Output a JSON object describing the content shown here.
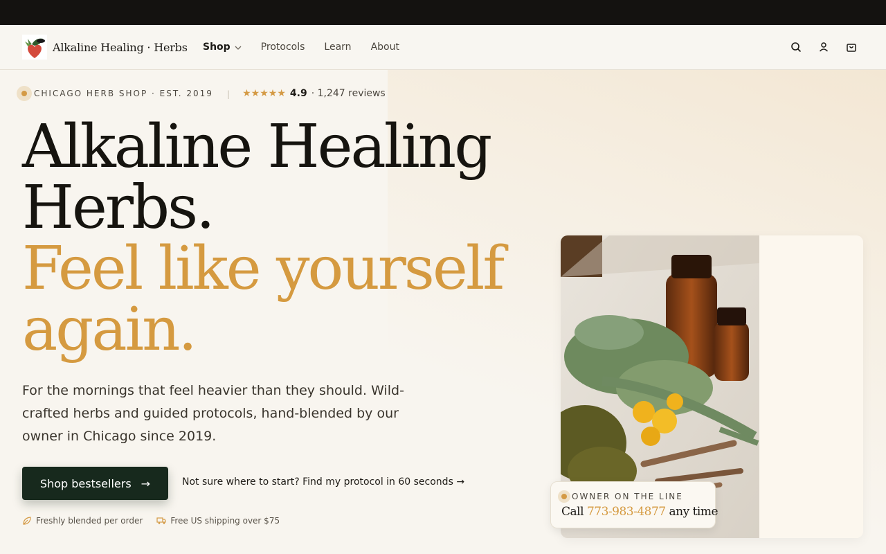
{
  "brand": {
    "name": "Alkaline Healing · Herbs"
  },
  "nav": {
    "items": [
      {
        "label": "Shop"
      },
      {
        "label": "Protocols"
      },
      {
        "label": "Learn"
      },
      {
        "label": "About"
      }
    ],
    "icons": [
      "search-icon",
      "account-icon",
      "cart-icon"
    ]
  },
  "hero": {
    "eyebrow": "CHICAGO HERB SHOP · EST. 2019",
    "stars": "★★★★★",
    "rating": "4.9",
    "reviews": "· 1,247 reviews",
    "headline_line1": "Alkaline Healing",
    "headline_line2": "Herbs.",
    "headline_line3": "Feel like yourself",
    "headline_line4": "again.",
    "lead": "For the mornings that feel heavier than they should. Wild-crafted herbs and guided protocols, hand-blended by our owner in Chicago since 2019.",
    "cta_label": "Shop bestsellers",
    "cta_arrow": "→",
    "secondary_link": "Not sure where to start? Find my protocol in 60 seconds →",
    "perks": [
      {
        "icon": "leaf-icon",
        "label": "Freshly blended per order"
      },
      {
        "icon": "truck-icon",
        "label": "Free US shipping over $75"
      }
    ]
  },
  "owner_card": {
    "label": "OWNER ON THE LINE",
    "prefix": "Call",
    "phone": "773-983-4877",
    "suffix": "any time"
  },
  "colors": {
    "accent_gold": "#d59a40",
    "cta_green": "#17291d",
    "topbar": "#141210",
    "background": "#f8f5ef"
  }
}
